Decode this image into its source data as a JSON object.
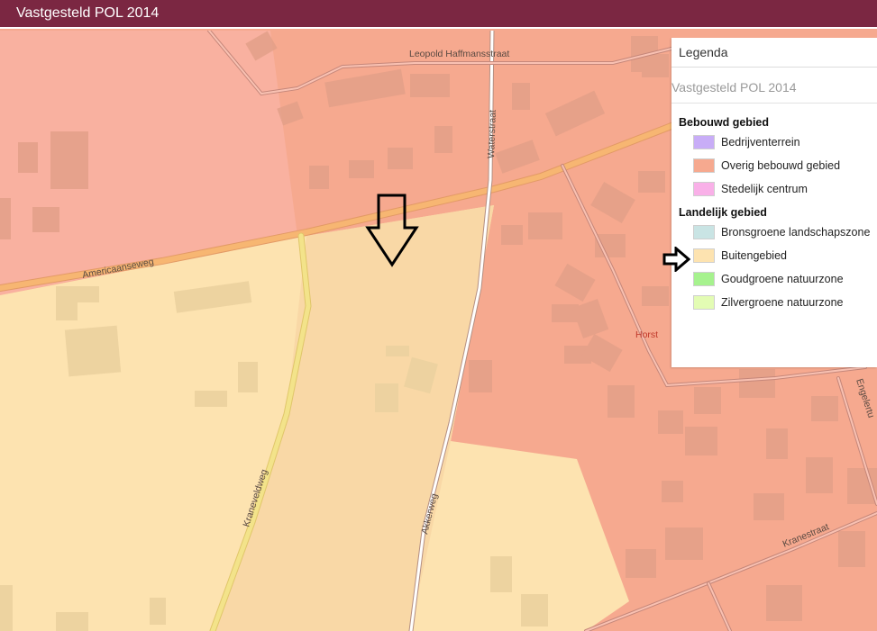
{
  "header": {
    "title": "Vastgesteld POL 2014",
    "bg_color": "#7b2742"
  },
  "map": {
    "colors": {
      "bebouwd": "#f6a98f",
      "buitengebied": "#fde3b0",
      "buitengebied_highlight": "#f9d8a6",
      "building": "#e3a088",
      "building_light": "#ecd2a0",
      "road_main": "#f7b672",
      "road_secondary": "#f3e38a",
      "road_minor": "#ffffff"
    },
    "street_labels": {
      "americaanseweg": "Americaanseweg",
      "leopold": "Leopold Haffmansstraat",
      "waterstraat": "Waterstraat",
      "kraneveldweg": "Kraneveldweg",
      "akkerweg": "Akkerweg",
      "kranestraat": "Kranestraat",
      "engelbertus": "Engelertu"
    },
    "place_label": "Horst"
  },
  "legend": {
    "title": "Legenda",
    "layer": "Vastgesteld POL 2014",
    "groups": [
      {
        "name": "Bebouwd gebied",
        "items": [
          {
            "label": "Bedrijventerrein",
            "color": "#c8adf7"
          },
          {
            "label": "Overig bebouwd gebied",
            "color": "#f6a98f"
          },
          {
            "label": "Stedelijk centrum",
            "color": "#f9b0e8"
          }
        ]
      },
      {
        "name": "Landelijk gebied",
        "items": [
          {
            "label": "Bronsgroene landschapszone",
            "color": "#c9e4e4"
          },
          {
            "label": "Buitengebied",
            "color": "#fde3b0"
          },
          {
            "label": "Goudgroene natuurzone",
            "color": "#a6f28e"
          },
          {
            "label": "Zilvergroene natuurzone",
            "color": "#e3fcb4"
          }
        ]
      }
    ]
  },
  "annotations": {
    "arrow_icon": "arrow-down-outline",
    "pointer_icon": "arrow-right-outline"
  }
}
